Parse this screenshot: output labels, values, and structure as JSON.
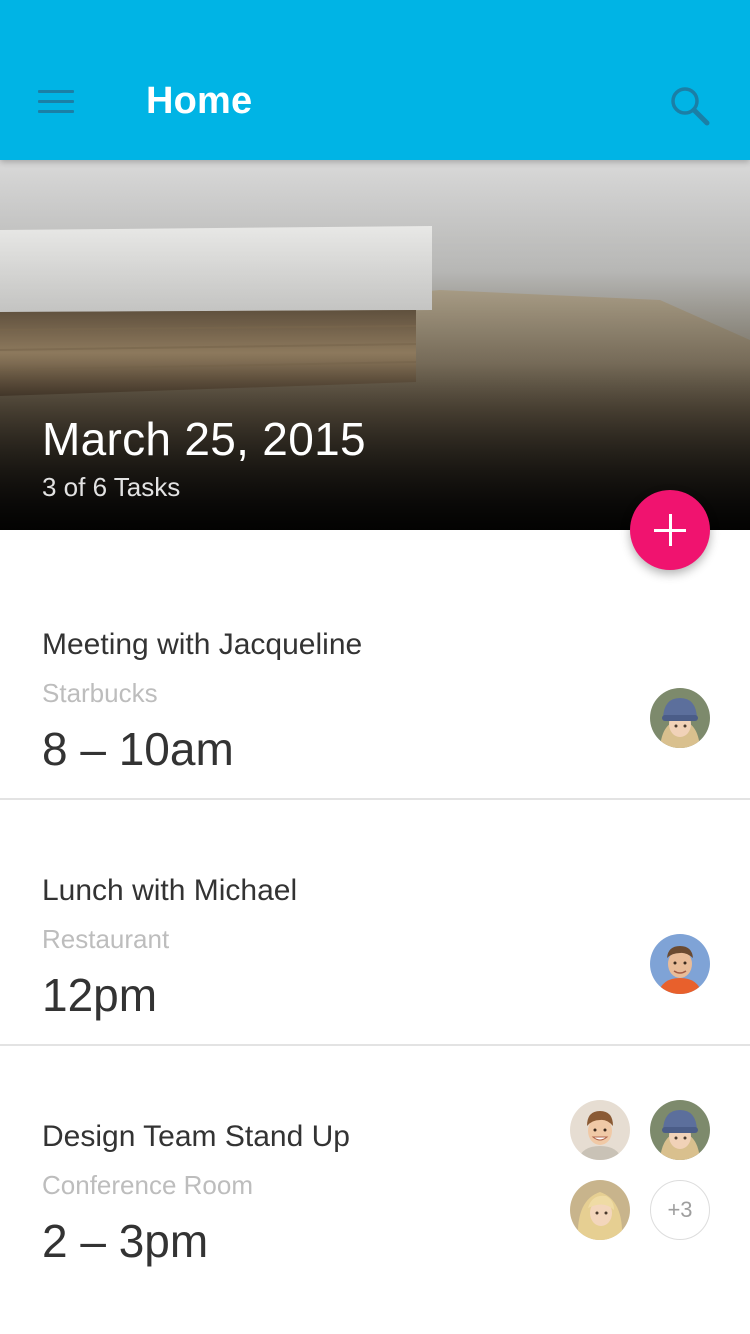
{
  "appbar": {
    "title": "Home",
    "color": "#00b4e5"
  },
  "hero": {
    "date": "March 25, 2015",
    "subtitle": "3 of 6 Tasks"
  },
  "fab": {
    "icon": "plus-icon",
    "color": "#f0136f"
  },
  "tasks": [
    {
      "title": "Meeting with Jacqueline",
      "place": "Starbucks",
      "time": "8 – 10am",
      "attendees": [
        "avatar-woman-beanie"
      ]
    },
    {
      "title": "Lunch with Michael",
      "place": "Restaurant",
      "time": "12pm",
      "attendees": [
        "avatar-man"
      ]
    },
    {
      "title": "Design Team Stand Up",
      "place": "Conference Room",
      "time": "2 – 3pm",
      "attendees": [
        "avatar-man-smiling",
        "avatar-woman-beanie",
        "avatar-woman-blonde"
      ],
      "more_count": "+3"
    }
  ]
}
